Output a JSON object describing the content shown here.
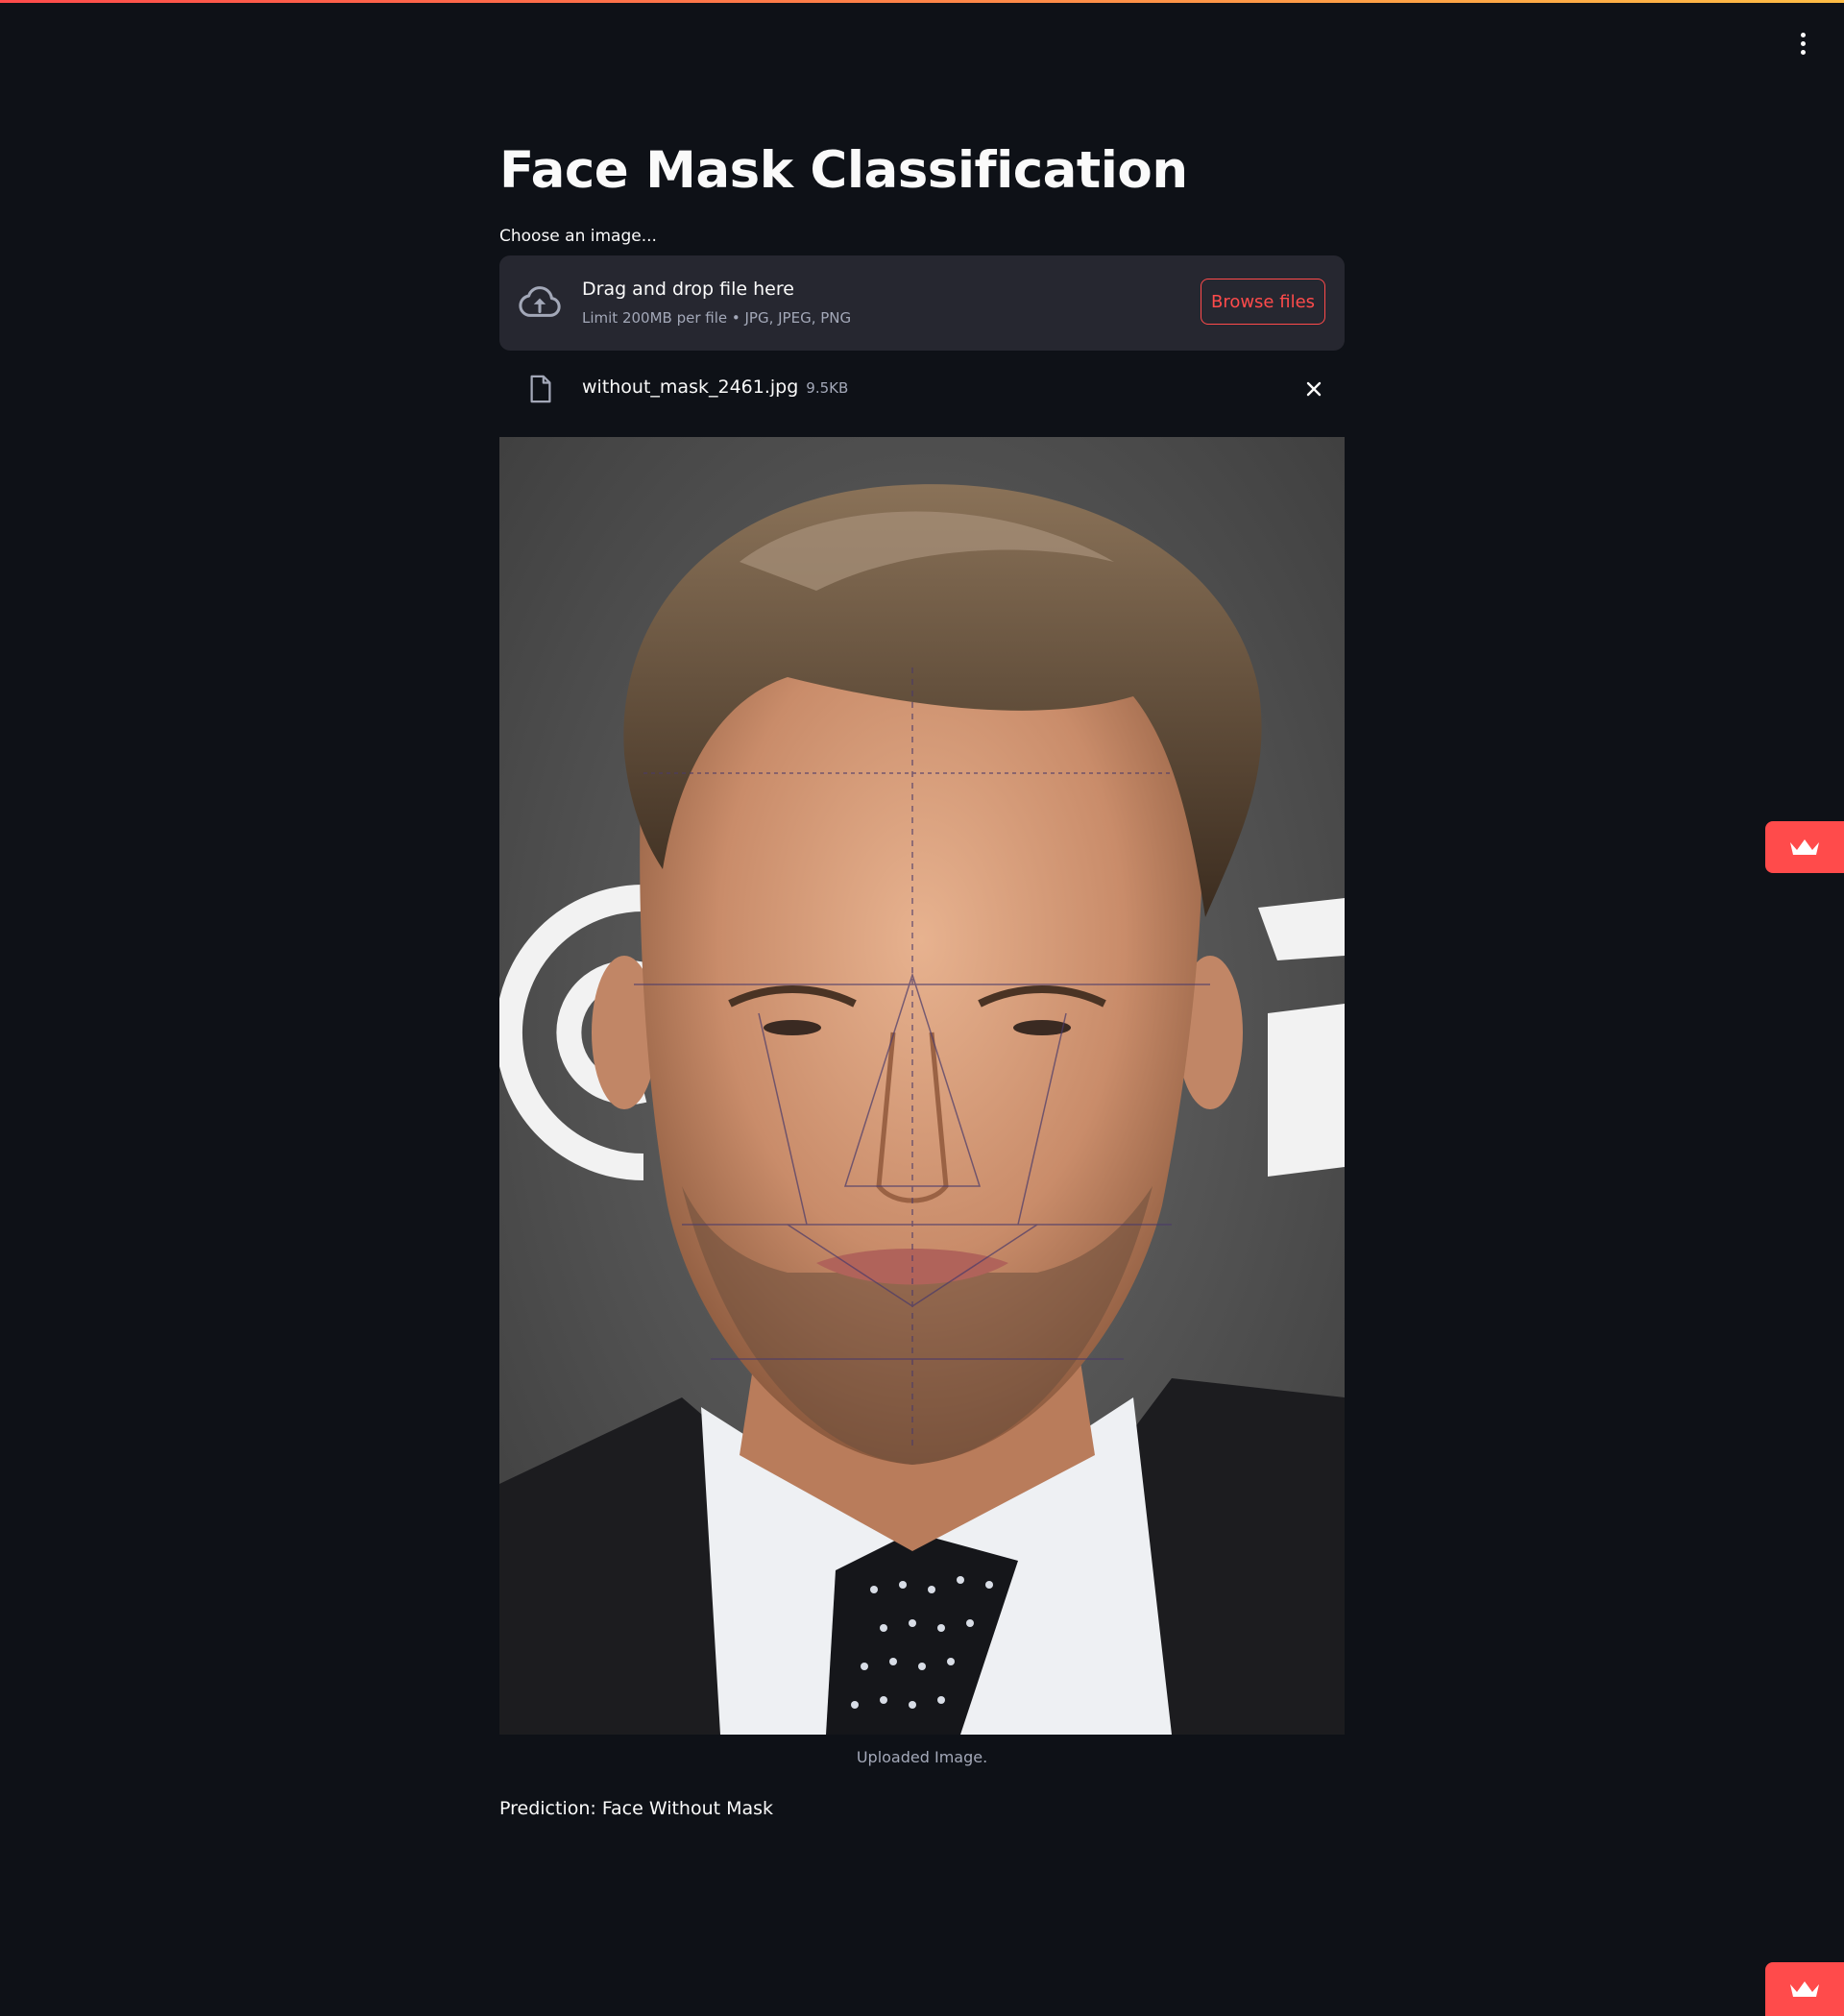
{
  "app": {
    "title": "Face Mask Classification"
  },
  "uploader": {
    "label": "Choose an image...",
    "dropzone_title": "Drag and drop file here",
    "dropzone_limit": "Limit 200MB per file • JPG, JPEG, PNG",
    "browse_label": "Browse files"
  },
  "file": {
    "name": "without_mask_2461.jpg",
    "size": "9.5KB"
  },
  "image": {
    "caption": "Uploaded Image."
  },
  "result": {
    "prediction": "Prediction: Face Without Mask"
  },
  "colors": {
    "background": "#0e1117",
    "accent": "#ff4b4b",
    "dropzone": "#262730"
  },
  "icons": [
    "menu-icon",
    "cloud-upload-icon",
    "file-icon",
    "close-icon",
    "crown-icon"
  ]
}
